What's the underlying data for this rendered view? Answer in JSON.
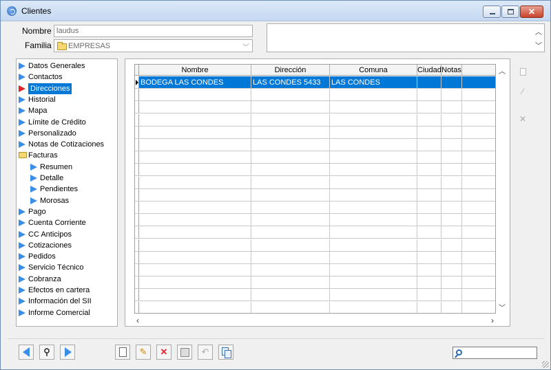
{
  "window": {
    "title": "Clientes",
    "close_glyph": "✕",
    "accent": "#0078d7"
  },
  "header": {
    "nombre_label": "Nombre",
    "nombre_value": "laudus",
    "familia_label": "Familia",
    "familia_value": "EMPRESAS"
  },
  "tree": {
    "items": [
      {
        "label": "Datos Generales",
        "icon": "arrow-right-icon"
      },
      {
        "label": "Contactos",
        "icon": "arrow-right-icon"
      },
      {
        "label": "Direcciones",
        "icon": "arrow-right-icon",
        "selected": true
      },
      {
        "label": "Historial",
        "icon": "arrow-right-icon"
      },
      {
        "label": "Mapa",
        "icon": "arrow-right-icon"
      },
      {
        "label": "Límite de Crédito",
        "icon": "arrow-right-icon"
      },
      {
        "label": "Personalizado",
        "icon": "arrow-right-icon"
      },
      {
        "label": "Notas de Cotizaciones",
        "icon": "arrow-right-icon"
      },
      {
        "label": "Facturas",
        "icon": "folder-icon"
      },
      {
        "label": "Resumen",
        "icon": "arrow-right-icon",
        "indent": true
      },
      {
        "label": "Detalle",
        "icon": "arrow-right-icon",
        "indent": true
      },
      {
        "label": "Pendientes",
        "icon": "arrow-right-icon",
        "indent": true
      },
      {
        "label": "Morosas",
        "icon": "arrow-right-icon",
        "indent": true
      },
      {
        "label": "Pago",
        "icon": "arrow-right-icon"
      },
      {
        "label": "Cuenta Corriente",
        "icon": "arrow-right-icon"
      },
      {
        "label": "CC Anticipos",
        "icon": "arrow-right-icon"
      },
      {
        "label": "Cotizaciones",
        "icon": "arrow-right-icon"
      },
      {
        "label": "Pedidos",
        "icon": "arrow-right-icon"
      },
      {
        "label": "Servicio Técnico",
        "icon": "arrow-right-icon"
      },
      {
        "label": "Cobranza",
        "icon": "arrow-right-icon"
      },
      {
        "label": "Efectos en cartera",
        "icon": "arrow-right-icon"
      },
      {
        "label": "Información del SII",
        "icon": "arrow-right-icon"
      },
      {
        "label": "Informe Comercial",
        "icon": "arrow-right-icon"
      }
    ]
  },
  "grid": {
    "columns": [
      "Nombre",
      "Dirección",
      "Comuna",
      "Ciudad",
      "Notas"
    ],
    "rows": [
      [
        "BODEGA LAS CONDES",
        "LAS CONDES 5433",
        "LAS CONDES",
        "",
        ""
      ]
    ]
  },
  "side_actions": {
    "new_icon": "new-document-icon",
    "edit_icon": "edit-pencil-icon",
    "delete_icon": "delete-x-icon",
    "edit_glyph": "⁄",
    "delete_glyph": "✕"
  },
  "toolbar": {
    "find_glyph": "⚲",
    "edit_glyph": "✎",
    "delete_glyph": "✕",
    "undo_glyph": "↶"
  },
  "search": {
    "value": ""
  }
}
